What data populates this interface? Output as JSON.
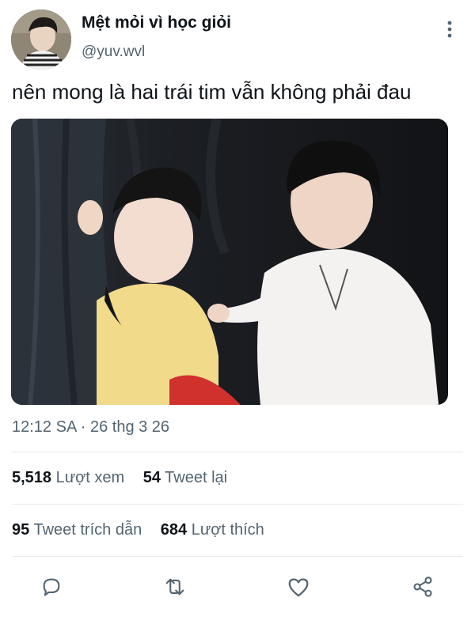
{
  "tweet": {
    "display_name": "Mệt mỏi vì học giỏi",
    "handle": "@yuv.wvl",
    "text": "nên mong là hai trái tim vẫn không phải đau",
    "timestamp": "12:12 SA · 26 thg 3 26",
    "media_alt": ""
  },
  "stats": {
    "views_count": "5,518",
    "views_label": "Lượt xem",
    "retweets_count": "54",
    "retweets_label": "Tweet lại",
    "quotes_count": "95",
    "quotes_label": "Tweet trích dẫn",
    "likes_count": "684",
    "likes_label": "Lượt thích"
  },
  "actions": [
    {
      "icon": "reply-icon"
    },
    {
      "icon": "retweet-icon"
    },
    {
      "icon": "like-icon"
    },
    {
      "icon": "share-icon"
    }
  ],
  "colors": {
    "text_primary": "#0f1419",
    "text_secondary": "#536471",
    "divider": "#e5e8eb",
    "background": "#ffffff"
  }
}
